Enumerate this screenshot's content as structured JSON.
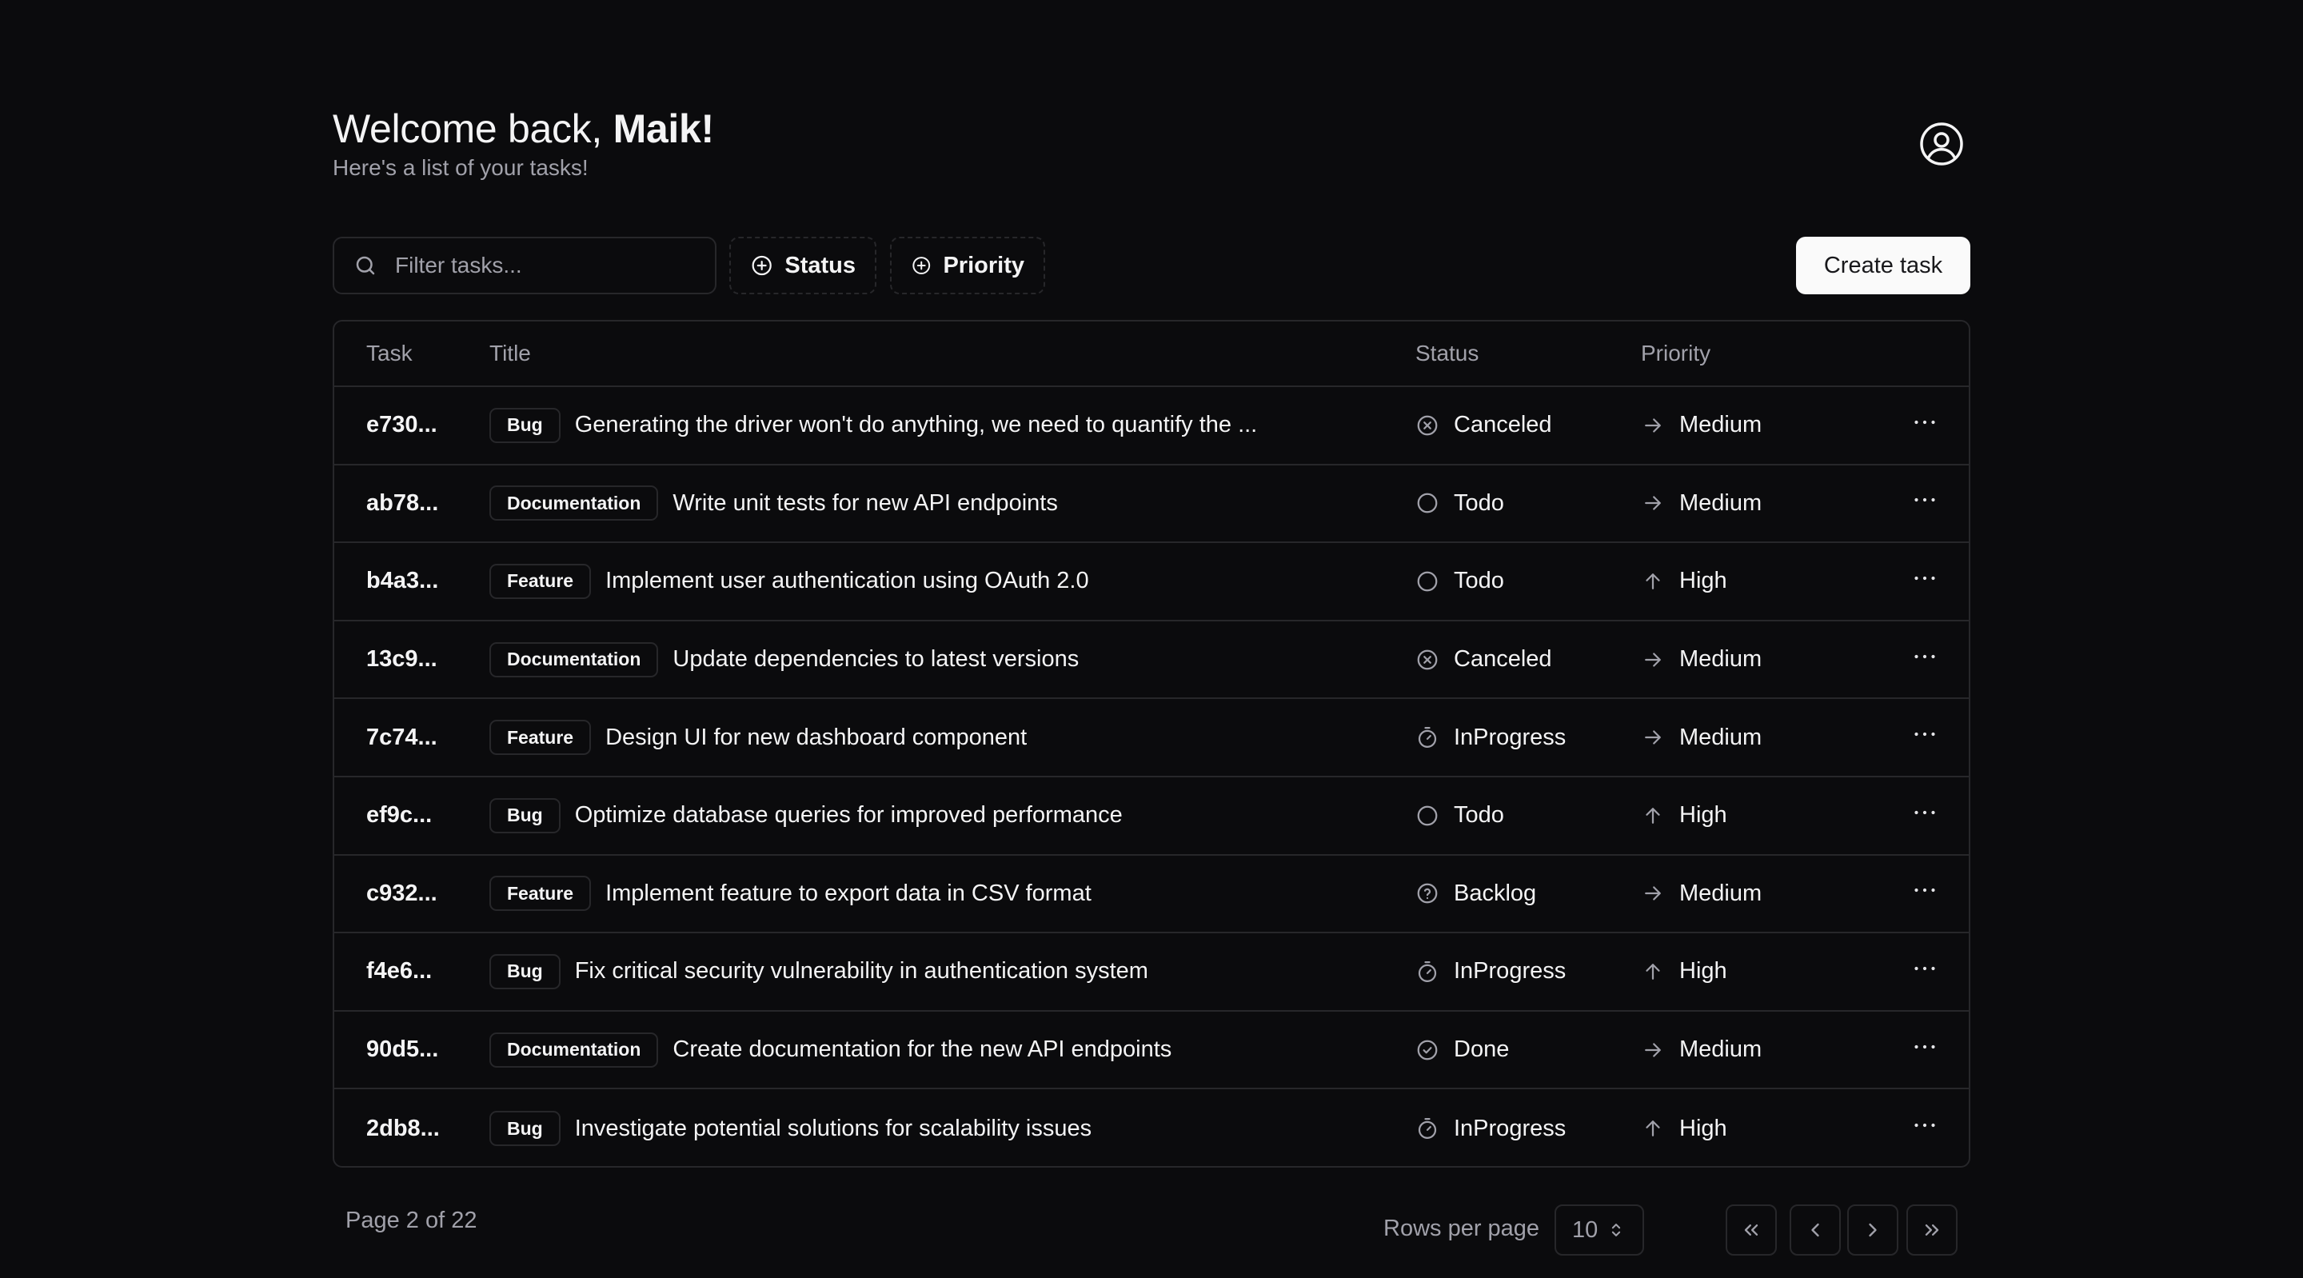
{
  "header": {
    "welcome_prefix": "Welcome back, ",
    "user_name": "Maik!",
    "subtitle": "Here's a list of your tasks!"
  },
  "toolbar": {
    "search_placeholder": "Filter tasks...",
    "search_value": "",
    "status_filter_label": "Status",
    "priority_filter_label": "Priority",
    "create_label": "Create task"
  },
  "table": {
    "columns": [
      "Task",
      "Title",
      "Status",
      "Priority"
    ],
    "rows": [
      {
        "id": "e730...",
        "label": "Bug",
        "title": "Generating the driver won't do anything, we need to quantify the ...",
        "status": "Canceled",
        "status_icon": "x-circle-icon",
        "priority": "Medium",
        "priority_icon": "arrow-right-icon"
      },
      {
        "id": "ab78...",
        "label": "Documentation",
        "title": "Write unit tests for new API endpoints",
        "status": "Todo",
        "status_icon": "circle-icon",
        "priority": "Medium",
        "priority_icon": "arrow-right-icon"
      },
      {
        "id": "b4a3...",
        "label": "Feature",
        "title": "Implement user authentication using OAuth 2.0",
        "status": "Todo",
        "status_icon": "circle-icon",
        "priority": "High",
        "priority_icon": "arrow-up-icon"
      },
      {
        "id": "13c9...",
        "label": "Documentation",
        "title": "Update dependencies to latest versions",
        "status": "Canceled",
        "status_icon": "x-circle-icon",
        "priority": "Medium",
        "priority_icon": "arrow-right-icon"
      },
      {
        "id": "7c74...",
        "label": "Feature",
        "title": "Design UI for new dashboard component",
        "status": "InProgress",
        "status_icon": "timer-icon",
        "priority": "Medium",
        "priority_icon": "arrow-right-icon"
      },
      {
        "id": "ef9c...",
        "label": "Bug",
        "title": "Optimize database queries for improved performance",
        "status": "Todo",
        "status_icon": "circle-icon",
        "priority": "High",
        "priority_icon": "arrow-up-icon"
      },
      {
        "id": "c932...",
        "label": "Feature",
        "title": "Implement feature to export data in CSV format",
        "status": "Backlog",
        "status_icon": "help-circle-icon",
        "priority": "Medium",
        "priority_icon": "arrow-right-icon"
      },
      {
        "id": "f4e6...",
        "label": "Bug",
        "title": "Fix critical security vulnerability in authentication system",
        "status": "InProgress",
        "status_icon": "timer-icon",
        "priority": "High",
        "priority_icon": "arrow-up-icon"
      },
      {
        "id": "90d5...",
        "label": "Documentation",
        "title": "Create documentation for the new API endpoints",
        "status": "Done",
        "status_icon": "check-circle-icon",
        "priority": "Medium",
        "priority_icon": "arrow-right-icon"
      },
      {
        "id": "2db8...",
        "label": "Bug",
        "title": "Investigate potential solutions for scalability issues",
        "status": "InProgress",
        "status_icon": "timer-icon",
        "priority": "High",
        "priority_icon": "arrow-up-icon"
      }
    ]
  },
  "footer": {
    "page_info": "Page 2 of 22",
    "rows_per_page_label": "Rows per page",
    "rows_per_page_value": "10"
  },
  "colors": {
    "background": "#0b0b0d",
    "border": "#27272a",
    "muted_text": "#a1a1aa",
    "text": "#f4f4f5",
    "primary_button_bg": "#fafafa"
  }
}
